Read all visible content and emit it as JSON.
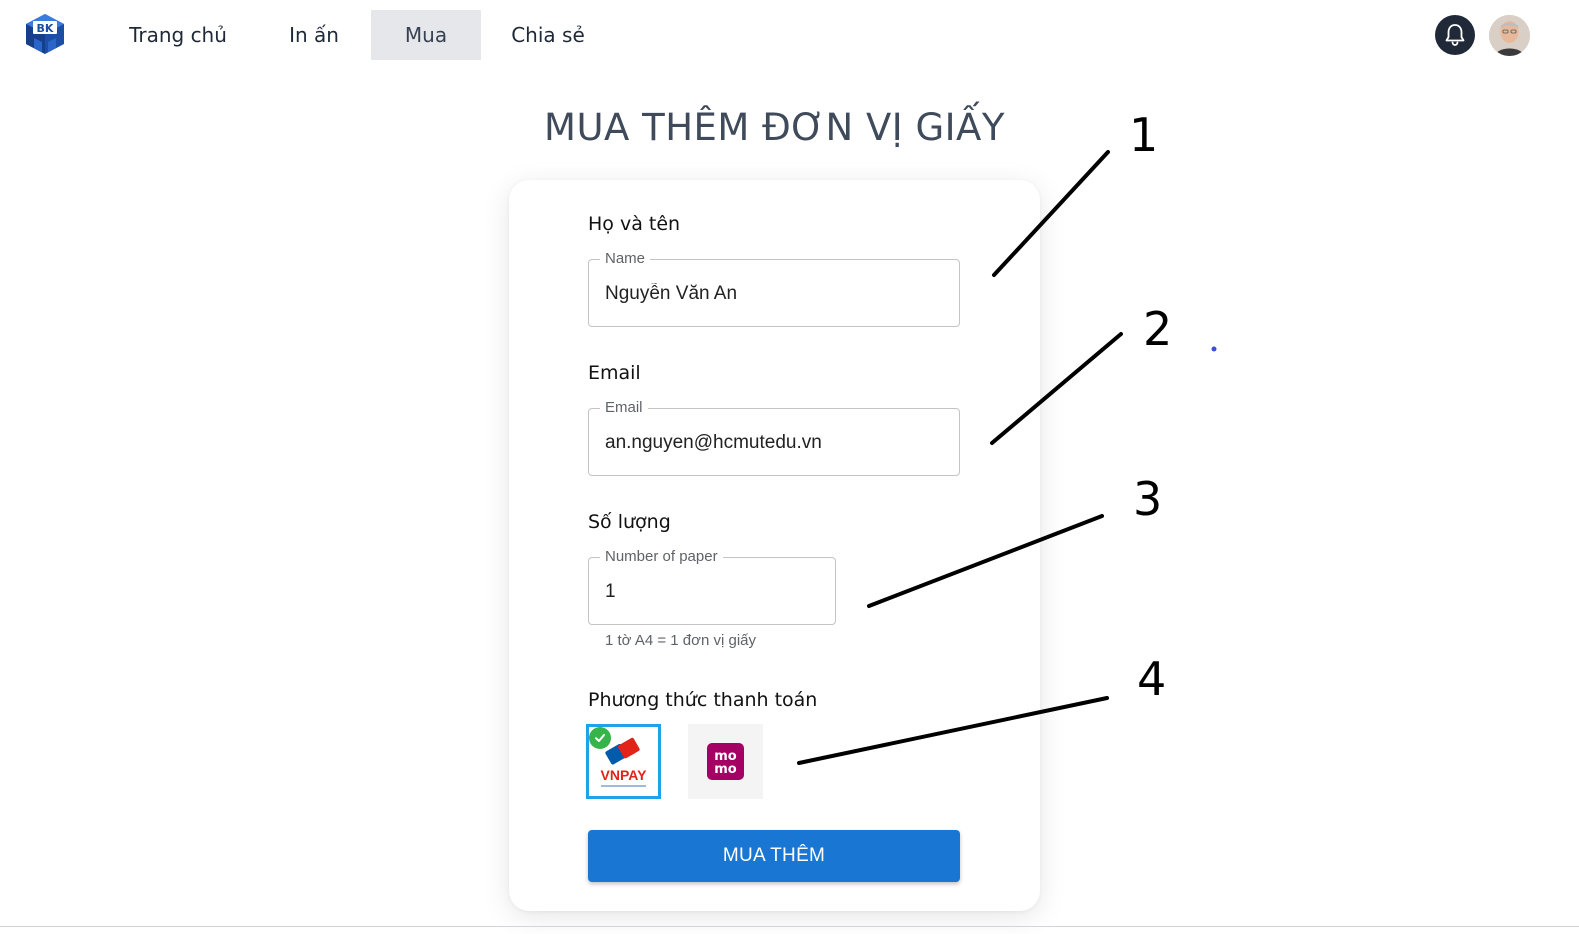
{
  "nav": {
    "logo_text": "BK",
    "items": [
      {
        "label": "Trang chủ",
        "active": false
      },
      {
        "label": "In ấn",
        "active": false
      },
      {
        "label": "Mua",
        "active": true
      },
      {
        "label": "Chia sẻ",
        "active": false
      }
    ]
  },
  "page_title": "MUA THÊM ĐƠN VỊ GIẤY",
  "form": {
    "name": {
      "label": "Họ và tên",
      "legend": "Name",
      "value": "Nguyễn Văn An"
    },
    "email": {
      "label": "Email",
      "legend": "Email",
      "value": "an.nguyen@hcmutedu.vn"
    },
    "quantity": {
      "label": "Số lượng",
      "legend": "Number of paper",
      "value": "1",
      "helper": "1 tờ A4 = 1 đơn vị giấy"
    },
    "payment": {
      "label": "Phương thức thanh toán",
      "methods": [
        {
          "name": "VNPAY",
          "selected": true
        },
        {
          "name": "momo",
          "selected": false
        }
      ]
    },
    "submit_label": "MUA THÊM"
  },
  "annotations": [
    "1",
    "2",
    "3",
    "4"
  ],
  "colors": {
    "primary": "#1976d2",
    "selected_border": "#1fa3e8",
    "nav_active_bg": "#e5e7eb",
    "title": "#3f4a5a",
    "momo": "#a50064",
    "vnpay_red": "#e2231a",
    "vnpay_blue": "#005baa"
  }
}
